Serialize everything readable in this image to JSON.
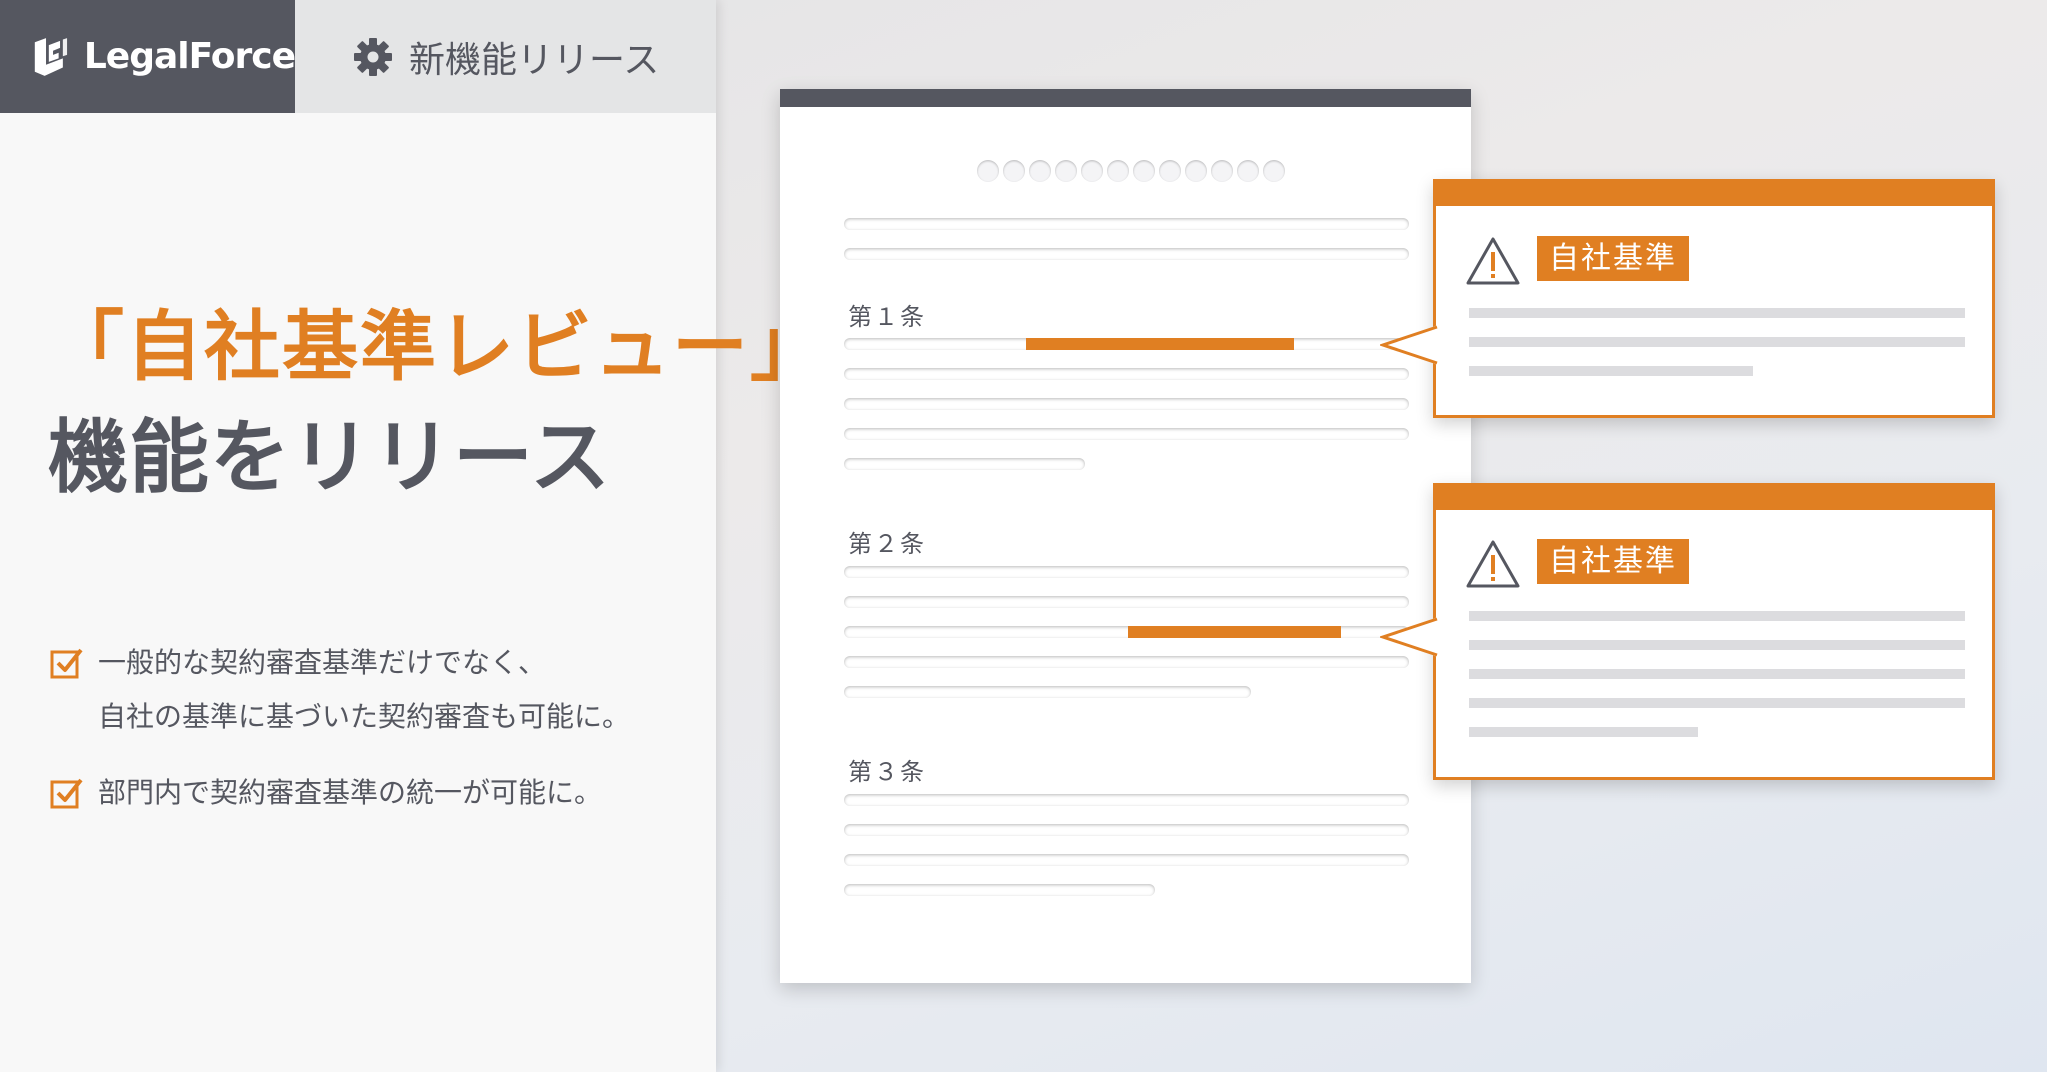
{
  "header": {
    "logo_text": "LegalForce",
    "release_label": "新機能リリース"
  },
  "headline": {
    "line1": "「自社基準レビュー」",
    "line2": "機能をリリース"
  },
  "features": [
    {
      "line1": "一般的な契約審査基準だけでなく、",
      "line2": "自社の基準に基づいた契約審査も可能に。"
    },
    {
      "line1": "部門内で契約審査基準の統一が可能に。"
    }
  ],
  "document": {
    "articles": [
      "第１条",
      "第２条",
      "第３条"
    ]
  },
  "callouts": [
    {
      "badge": "自社基準"
    },
    {
      "badge": "自社基準"
    }
  ],
  "colors": {
    "accent": "#e07f22",
    "dark": "#555760"
  },
  "icons": [
    "logo-icon",
    "gear-icon",
    "checkbox-icon",
    "warning-icon"
  ]
}
